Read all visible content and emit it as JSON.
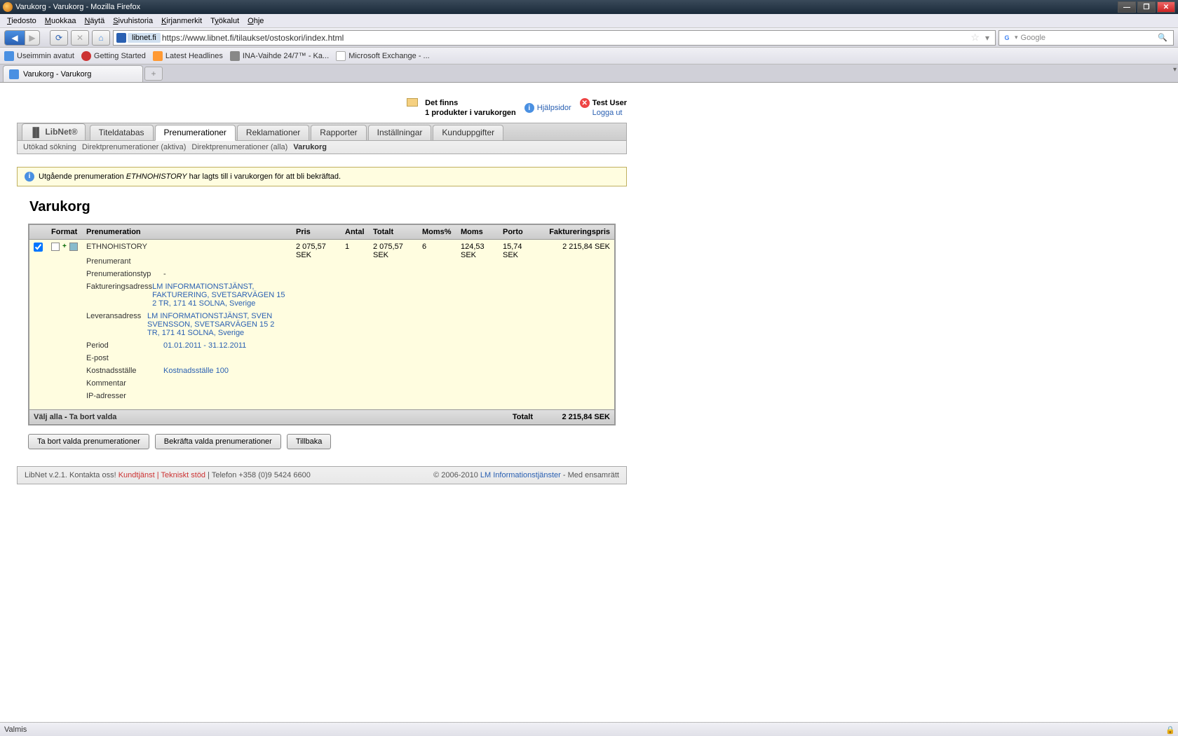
{
  "window": {
    "title": "Varukorg - Varukorg - Mozilla Firefox"
  },
  "menu": {
    "items": [
      "Tiedosto",
      "Muokkaa",
      "Näytä",
      "Sivuhistoria",
      "Kirjanmerkit",
      "Työkalut",
      "Ohje"
    ]
  },
  "nav": {
    "url_site": "libnet.fi",
    "url": "https://www.libnet.fi/tilaukset/ostoskori/index.html",
    "search_placeholder": "Google"
  },
  "bookmarks": {
    "b0": "Useimmin avatut",
    "b1": "Getting Started",
    "b2": "Latest Headlines",
    "b3": "INA-Vaihde 24/7™ - Ka...",
    "b4": "Microsoft Exchange - ..."
  },
  "browsertab": {
    "title": "Varukorg - Varukorg"
  },
  "header": {
    "cart_line1": "Det finns",
    "cart_line2": "1 produkter i varukorgen",
    "help": "Hjälpsidor",
    "user": "Test User",
    "logout": "Logga ut"
  },
  "logo": "LibNet®",
  "tabs": {
    "t0": "Titeldatabas",
    "t1": "Prenumerationer",
    "t2": "Reklamationer",
    "t3": "Rapporter",
    "t4": "Inställningar",
    "t5": "Kunduppgifter"
  },
  "subnav": {
    "s0": "Utökad sökning",
    "s1": "Direktprenumerationer (aktiva)",
    "s2": "Direktprenumerationer (alla)",
    "s3": "Varukorg"
  },
  "alert": {
    "pre": "Utgående prenumeration ",
    "em": "ETHNOHISTORY",
    "post": " har lagts till i varukorgen för att bli bekräftad."
  },
  "page_title": "Varukorg",
  "cols": {
    "c0": "",
    "c1": "Format",
    "c2": "Prenumeration",
    "c3": "Pris",
    "c4": "Antal",
    "c5": "Totalt",
    "c6": "Moms%",
    "c7": "Moms",
    "c8": "Porto",
    "c9": "Faktureringspris"
  },
  "row": {
    "title": "ETHNOHISTORY",
    "pris": "2 075,57 SEK",
    "antal": "1",
    "totalt": "2 075,57 SEK",
    "momsp": "6",
    "moms": "124,53 SEK",
    "porto": "15,74 SEK",
    "fakt": "2 215,84 SEK"
  },
  "details": {
    "l0": "Prenumerant",
    "v0": "",
    "l1": "Prenumerationstyp",
    "v1": "-",
    "l2": "Faktureringsadress",
    "v2": "LM INFORMATIONSTJÄNST, FAKTURERING, SVETSARVÄGEN 15 2 TR, 171 41 SOLNA, Sverige",
    "l3": "Leveransadress",
    "v3": "LM INFORMATIONSTJÄNST, SVEN SVENSSON, SVETSARVÄGEN 15 2 TR, 171 41 SOLNA, Sverige",
    "l4": "Period",
    "v4": "01.01.2011 - 31.12.2011",
    "l5": "E-post",
    "v5": "",
    "l6": "Kostnadsställe",
    "v6": "Kostnadsställe 100",
    "l7": "Kommentar",
    "v7": "",
    "l8": "IP-adresser",
    "v8": ""
  },
  "tfoot": {
    "selall": "Välj alla",
    "sep": "  -  ",
    "remsel": "Ta bort valda",
    "totlabel": "Totalt",
    "totval": "2 215,84 SEK"
  },
  "actions": {
    "a0": "Ta bort valda prenumerationer",
    "a1": "Bekräfta valda prenumerationer",
    "a2": "Tillbaka"
  },
  "footer": {
    "left_pre": "LibNet v.2.1. Kontakta oss! ",
    "l0": "Kundtjänst",
    "l1": "Tekniskt stöd",
    "left_post": " | Telefon +358 (0)9 5424 6600",
    "right_pre": "© 2006-2010 ",
    "rlink": "LM Informationstjänster",
    "right_post": " - Med ensamrätt"
  },
  "status": "Valmis"
}
